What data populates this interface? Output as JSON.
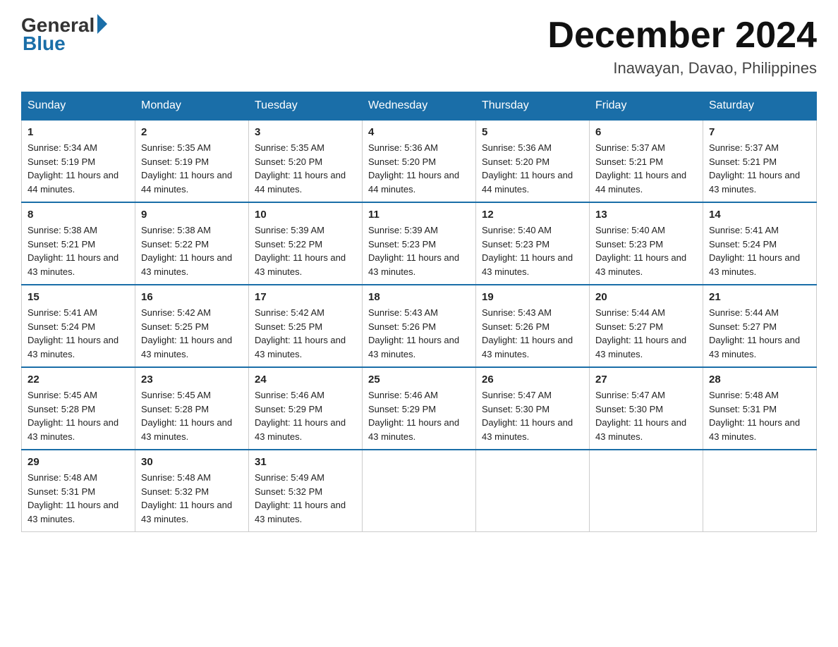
{
  "header": {
    "logo_general": "General",
    "logo_blue": "Blue",
    "month_title": "December 2024",
    "location": "Inawayan, Davao, Philippines"
  },
  "days_of_week": [
    "Sunday",
    "Monday",
    "Tuesday",
    "Wednesday",
    "Thursday",
    "Friday",
    "Saturday"
  ],
  "weeks": [
    [
      {
        "day": "1",
        "sunrise": "Sunrise: 5:34 AM",
        "sunset": "Sunset: 5:19 PM",
        "daylight": "Daylight: 11 hours and 44 minutes."
      },
      {
        "day": "2",
        "sunrise": "Sunrise: 5:35 AM",
        "sunset": "Sunset: 5:19 PM",
        "daylight": "Daylight: 11 hours and 44 minutes."
      },
      {
        "day": "3",
        "sunrise": "Sunrise: 5:35 AM",
        "sunset": "Sunset: 5:20 PM",
        "daylight": "Daylight: 11 hours and 44 minutes."
      },
      {
        "day": "4",
        "sunrise": "Sunrise: 5:36 AM",
        "sunset": "Sunset: 5:20 PM",
        "daylight": "Daylight: 11 hours and 44 minutes."
      },
      {
        "day": "5",
        "sunrise": "Sunrise: 5:36 AM",
        "sunset": "Sunset: 5:20 PM",
        "daylight": "Daylight: 11 hours and 44 minutes."
      },
      {
        "day": "6",
        "sunrise": "Sunrise: 5:37 AM",
        "sunset": "Sunset: 5:21 PM",
        "daylight": "Daylight: 11 hours and 44 minutes."
      },
      {
        "day": "7",
        "sunrise": "Sunrise: 5:37 AM",
        "sunset": "Sunset: 5:21 PM",
        "daylight": "Daylight: 11 hours and 43 minutes."
      }
    ],
    [
      {
        "day": "8",
        "sunrise": "Sunrise: 5:38 AM",
        "sunset": "Sunset: 5:21 PM",
        "daylight": "Daylight: 11 hours and 43 minutes."
      },
      {
        "day": "9",
        "sunrise": "Sunrise: 5:38 AM",
        "sunset": "Sunset: 5:22 PM",
        "daylight": "Daylight: 11 hours and 43 minutes."
      },
      {
        "day": "10",
        "sunrise": "Sunrise: 5:39 AM",
        "sunset": "Sunset: 5:22 PM",
        "daylight": "Daylight: 11 hours and 43 minutes."
      },
      {
        "day": "11",
        "sunrise": "Sunrise: 5:39 AM",
        "sunset": "Sunset: 5:23 PM",
        "daylight": "Daylight: 11 hours and 43 minutes."
      },
      {
        "day": "12",
        "sunrise": "Sunrise: 5:40 AM",
        "sunset": "Sunset: 5:23 PM",
        "daylight": "Daylight: 11 hours and 43 minutes."
      },
      {
        "day": "13",
        "sunrise": "Sunrise: 5:40 AM",
        "sunset": "Sunset: 5:23 PM",
        "daylight": "Daylight: 11 hours and 43 minutes."
      },
      {
        "day": "14",
        "sunrise": "Sunrise: 5:41 AM",
        "sunset": "Sunset: 5:24 PM",
        "daylight": "Daylight: 11 hours and 43 minutes."
      }
    ],
    [
      {
        "day": "15",
        "sunrise": "Sunrise: 5:41 AM",
        "sunset": "Sunset: 5:24 PM",
        "daylight": "Daylight: 11 hours and 43 minutes."
      },
      {
        "day": "16",
        "sunrise": "Sunrise: 5:42 AM",
        "sunset": "Sunset: 5:25 PM",
        "daylight": "Daylight: 11 hours and 43 minutes."
      },
      {
        "day": "17",
        "sunrise": "Sunrise: 5:42 AM",
        "sunset": "Sunset: 5:25 PM",
        "daylight": "Daylight: 11 hours and 43 minutes."
      },
      {
        "day": "18",
        "sunrise": "Sunrise: 5:43 AM",
        "sunset": "Sunset: 5:26 PM",
        "daylight": "Daylight: 11 hours and 43 minutes."
      },
      {
        "day": "19",
        "sunrise": "Sunrise: 5:43 AM",
        "sunset": "Sunset: 5:26 PM",
        "daylight": "Daylight: 11 hours and 43 minutes."
      },
      {
        "day": "20",
        "sunrise": "Sunrise: 5:44 AM",
        "sunset": "Sunset: 5:27 PM",
        "daylight": "Daylight: 11 hours and 43 minutes."
      },
      {
        "day": "21",
        "sunrise": "Sunrise: 5:44 AM",
        "sunset": "Sunset: 5:27 PM",
        "daylight": "Daylight: 11 hours and 43 minutes."
      }
    ],
    [
      {
        "day": "22",
        "sunrise": "Sunrise: 5:45 AM",
        "sunset": "Sunset: 5:28 PM",
        "daylight": "Daylight: 11 hours and 43 minutes."
      },
      {
        "day": "23",
        "sunrise": "Sunrise: 5:45 AM",
        "sunset": "Sunset: 5:28 PM",
        "daylight": "Daylight: 11 hours and 43 minutes."
      },
      {
        "day": "24",
        "sunrise": "Sunrise: 5:46 AM",
        "sunset": "Sunset: 5:29 PM",
        "daylight": "Daylight: 11 hours and 43 minutes."
      },
      {
        "day": "25",
        "sunrise": "Sunrise: 5:46 AM",
        "sunset": "Sunset: 5:29 PM",
        "daylight": "Daylight: 11 hours and 43 minutes."
      },
      {
        "day": "26",
        "sunrise": "Sunrise: 5:47 AM",
        "sunset": "Sunset: 5:30 PM",
        "daylight": "Daylight: 11 hours and 43 minutes."
      },
      {
        "day": "27",
        "sunrise": "Sunrise: 5:47 AM",
        "sunset": "Sunset: 5:30 PM",
        "daylight": "Daylight: 11 hours and 43 minutes."
      },
      {
        "day": "28",
        "sunrise": "Sunrise: 5:48 AM",
        "sunset": "Sunset: 5:31 PM",
        "daylight": "Daylight: 11 hours and 43 minutes."
      }
    ],
    [
      {
        "day": "29",
        "sunrise": "Sunrise: 5:48 AM",
        "sunset": "Sunset: 5:31 PM",
        "daylight": "Daylight: 11 hours and 43 minutes."
      },
      {
        "day": "30",
        "sunrise": "Sunrise: 5:48 AM",
        "sunset": "Sunset: 5:32 PM",
        "daylight": "Daylight: 11 hours and 43 minutes."
      },
      {
        "day": "31",
        "sunrise": "Sunrise: 5:49 AM",
        "sunset": "Sunset: 5:32 PM",
        "daylight": "Daylight: 11 hours and 43 minutes."
      },
      null,
      null,
      null,
      null
    ]
  ]
}
